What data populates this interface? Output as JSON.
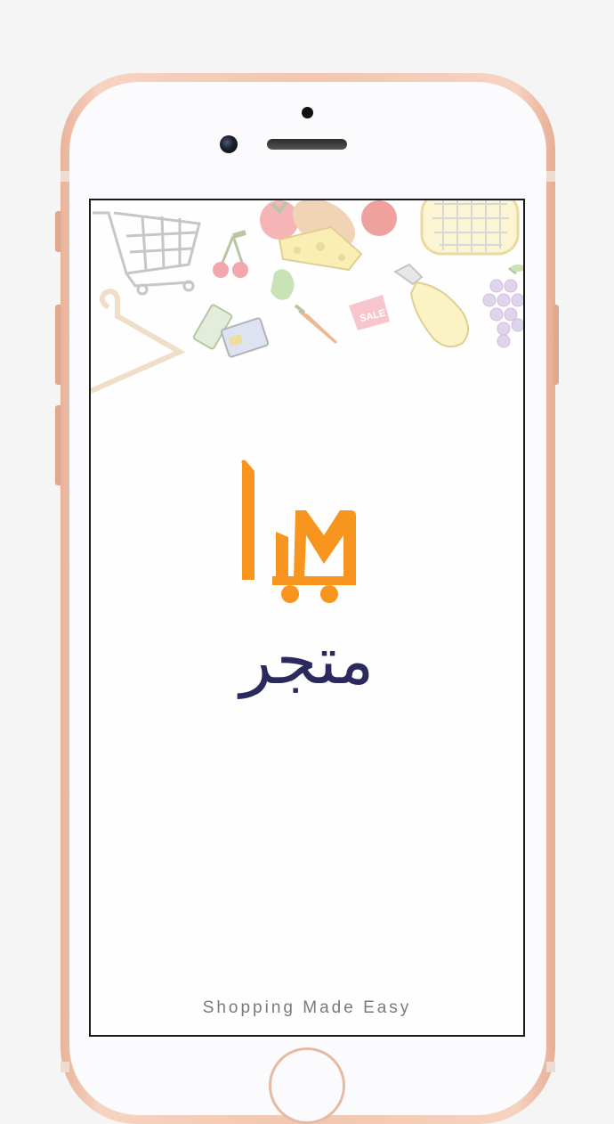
{
  "app": {
    "name_ar": "متجر",
    "tagline": "Shopping Made Easy"
  },
  "colors": {
    "logo_orange": "#f7951e",
    "brand_navy": "#2a2a5c",
    "tagline_gray": "#7a7a7a"
  },
  "decor": {
    "sale_tag": "SALE",
    "icons": [
      "shopping-cart-icon",
      "cherries-icon",
      "tomato-icon",
      "cheese-bread-icon",
      "basket-icon",
      "hanger-icon",
      "credit-card-icon",
      "vegetables-icon",
      "sale-tag-icon",
      "spray-bottle-icon",
      "grapes-icon"
    ]
  }
}
